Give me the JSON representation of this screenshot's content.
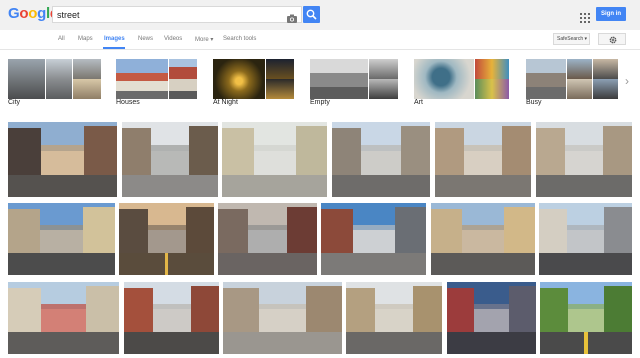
{
  "logo": {
    "letters": [
      {
        "ch": "G",
        "color": "#4285f4"
      },
      {
        "ch": "o",
        "color": "#ea4335"
      },
      {
        "ch": "o",
        "color": "#fbbc05"
      },
      {
        "ch": "g",
        "color": "#4285f4"
      },
      {
        "ch": "l",
        "color": "#34a853"
      },
      {
        "ch": "e",
        "color": "#ea4335"
      }
    ]
  },
  "search": {
    "query": "street"
  },
  "header": {
    "signin_label": "Sign in"
  },
  "tabs": [
    "All",
    "Maps",
    "Images",
    "News",
    "Videos",
    "More",
    "Search tools"
  ],
  "more_label": "More",
  "safesearch_label": "SafeSearch",
  "chips": [
    {
      "label": "City"
    },
    {
      "label": "Houses"
    },
    {
      "label": "At Night"
    },
    {
      "label": "Empty"
    },
    {
      "label": "Art"
    },
    {
      "label": "Busy"
    }
  ],
  "colors": {
    "accent": "#4285f4"
  }
}
